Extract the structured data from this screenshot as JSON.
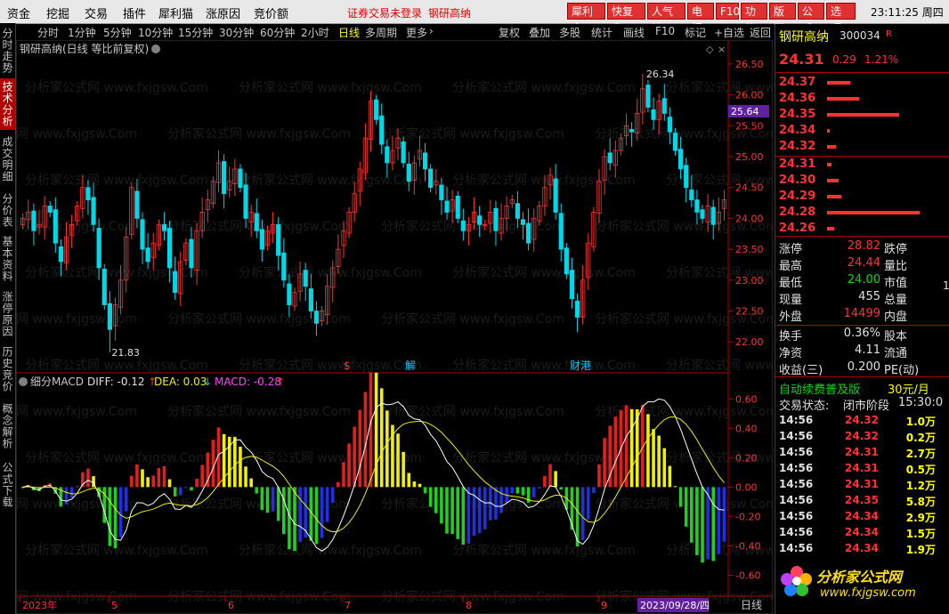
{
  "menu": {
    "items": [
      "资金",
      "挖掘",
      "交易",
      "插件",
      "犀利猫",
      "涨原因",
      "竞价额"
    ],
    "notice1": "证券交易未登录",
    "notice2": "钢研高纳",
    "buttons": [
      "犀利宝",
      "快复盘",
      "人气榜",
      "电报",
      "F10",
      "功能",
      "版面",
      "公式",
      "选项"
    ],
    "clock": "23:11:25 周四"
  },
  "toolbar": {
    "periods": [
      "分时",
      "1分钟",
      "5分钟",
      "10分钟",
      "15分钟",
      "30分钟",
      "60分钟",
      "2小时",
      "日线",
      "多周期",
      "更多"
    ],
    "active": "日线",
    "right": [
      "复权",
      "叠加",
      "多股",
      "统计",
      "画线",
      "F10",
      "标记",
      "+自选",
      "返回"
    ]
  },
  "sidebar": {
    "tabs": [
      "分时走势",
      "技术分析",
      "成交明细",
      "分价表",
      "基本资料",
      "涨停原因",
      "历史竞价",
      "概念解析",
      "公式下载"
    ],
    "active": "技术分析"
  },
  "chart": {
    "title": "钢研高纳(日线 等比前复权)",
    "high_label": "26.34",
    "low_label": "21.83",
    "price_tag": "25.64",
    "events": [
      "$",
      "解",
      "财港"
    ],
    "watermark": "分析家公式网 www.fxjgsw.Com",
    "macd_title": "细分MACD",
    "diff_label": "DIFF: -0.12",
    "dea_label": "DEA: 0.03",
    "macd_label": "MACD: -0.28",
    "price_axis": [
      "26.50",
      "26.00",
      "25.50",
      "25.00",
      "24.50",
      "24.00",
      "23.50",
      "23.00",
      "22.50",
      "22.00"
    ],
    "macd_axis": [
      "0.60",
      "0.40",
      "0.20",
      "0.00",
      "-0.20",
      "-0.40",
      "-0.60"
    ],
    "date_axis": [
      "2023年",
      "5",
      "6",
      "7",
      "8",
      "9"
    ],
    "date_box": "2023/09/28/四",
    "period_label": "日线",
    "colors": {
      "up": "#ff3232",
      "down": "#00d8e8",
      "macd_red": "#e02020",
      "macd_yellow": "#f0f000",
      "macd_green": "#20d020",
      "macd_blue": "#2030e0",
      "diff": "#ffffff",
      "dea": "#f0f000"
    }
  },
  "chart_data": {
    "type": "candlestick",
    "title": "钢研高纳(日线 等比前复权)",
    "ylim": [
      21.7,
      26.6
    ],
    "closes": [
      24.0,
      24.1,
      23.8,
      23.9,
      24.2,
      24.1,
      23.6,
      23.3,
      23.7,
      23.9,
      24.2,
      24.5,
      24.3,
      23.9,
      23.2,
      22.6,
      22.2,
      22.6,
      23.0,
      23.7,
      24.5,
      24.0,
      23.5,
      23.3,
      23.6,
      23.9,
      23.8,
      23.2,
      22.8,
      23.3,
      23.6,
      23.2,
      23.8,
      24.1,
      24.3,
      24.6,
      24.9,
      24.4,
      24.6,
      24.8,
      24.5,
      24.0,
      24.1,
      23.8,
      23.5,
      23.8,
      23.9,
      23.4,
      23.0,
      22.6,
      22.8,
      23.1,
      22.9,
      22.5,
      22.3,
      22.5,
      22.9,
      23.2,
      23.5,
      23.8,
      24.1,
      24.4,
      24.8,
      25.3,
      25.9,
      25.6,
      25.2,
      24.9,
      25.1,
      25.3,
      24.9,
      24.6,
      24.9,
      25.1,
      24.8,
      24.5,
      24.6,
      24.3,
      24.1,
      24.3,
      24.0,
      23.8,
      23.9,
      24.1,
      23.9,
      23.9,
      24.1,
      23.8,
      24.0,
      24.2,
      24.3,
      24.0,
      23.9,
      23.6,
      24.0,
      24.2,
      24.5,
      24.7,
      24.1,
      23.5,
      23.1,
      22.7,
      22.4,
      23.0,
      23.6,
      24.1,
      24.6,
      25.0,
      24.9,
      25.1,
      25.3,
      25.5,
      25.4,
      25.7,
      26.1,
      25.8,
      25.6,
      25.9,
      25.7,
      25.4,
      25.1,
      24.8,
      24.5,
      24.3,
      24.1,
      24.0,
      24.2,
      23.9,
      24.1,
      24.3
    ],
    "high": 26.34,
    "low": 21.83,
    "macd": {
      "diff_last": -0.12,
      "dea_last": 0.03,
      "macd_last": -0.28,
      "ylim": [
        -0.7,
        0.65
      ]
    },
    "x_ticks": [
      "2023年",
      "5",
      "6",
      "7",
      "8",
      "9"
    ],
    "last_date": "2023/09/28/四"
  },
  "quote": {
    "name": "钢研高纳",
    "code": "300034",
    "badge": "R",
    "price": "24.31",
    "change": "0.29",
    "pct": "1.21%",
    "asks": [
      {
        "price": "24.37",
        "bar": 0.2
      },
      {
        "price": "24.36",
        "bar": 0.28
      },
      {
        "price": "24.35",
        "bar": 0.62
      },
      {
        "price": "24.34",
        "bar": 0.02
      },
      {
        "price": "24.32",
        "bar": 0.08
      }
    ],
    "bids": [
      {
        "price": "24.31",
        "bar": 0.04
      },
      {
        "price": "24.30",
        "bar": 0.1
      },
      {
        "price": "24.29",
        "bar": 0.12
      },
      {
        "price": "24.28",
        "bar": 0.8
      },
      {
        "price": "24.26",
        "bar": 0.06
      }
    ],
    "stats": [
      {
        "l": "涨停",
        "v": "28.82",
        "c": "red",
        "r": "跌停"
      },
      {
        "l": "最高",
        "v": "24.44",
        "c": "red",
        "r": "量比"
      },
      {
        "l": "最低",
        "v": "24.00",
        "c": "green",
        "r": "市值"
      },
      {
        "l": "现量",
        "v": "455",
        "c": "white",
        "r": "总量"
      },
      {
        "l": "外盘",
        "v": "14499",
        "c": "red",
        "r": "内盘"
      },
      {
        "l": "换手",
        "v": "0.36%",
        "c": "white",
        "r": "股本"
      },
      {
        "l": "净资",
        "v": "4.11",
        "c": "white",
        "r": "流通"
      },
      {
        "l": "收益(三)",
        "v": "0.200",
        "c": "white",
        "r": "PE(动)"
      }
    ],
    "market_value_tail": "1",
    "promo": "自动续费普及版",
    "promo_price": "30元/月",
    "status_label": "交易状态:",
    "status_value": "闭市阶段",
    "status_time": "15:30:0",
    "ticks": [
      {
        "t": "14:56",
        "p": "24.32",
        "v": "1.0万"
      },
      {
        "t": "14:56",
        "p": "24.32",
        "v": "0.2万"
      },
      {
        "t": "14:56",
        "p": "24.31",
        "v": "2.7万"
      },
      {
        "t": "14:56",
        "p": "24.31",
        "v": "0.5万"
      },
      {
        "t": "14:56",
        "p": "24.31",
        "v": "1.2万"
      },
      {
        "t": "14:56",
        "p": "24.35",
        "v": "5.8万"
      },
      {
        "t": "14:56",
        "p": "24.34",
        "v": "2.9万"
      },
      {
        "t": "14:56",
        "p": "24.34",
        "v": "1.5万"
      },
      {
        "t": "14:56",
        "p": "24.34",
        "v": "1.9万"
      }
    ],
    "logo_text": "分析家公式网",
    "logo_url": "www.fxjgsw.com"
  }
}
